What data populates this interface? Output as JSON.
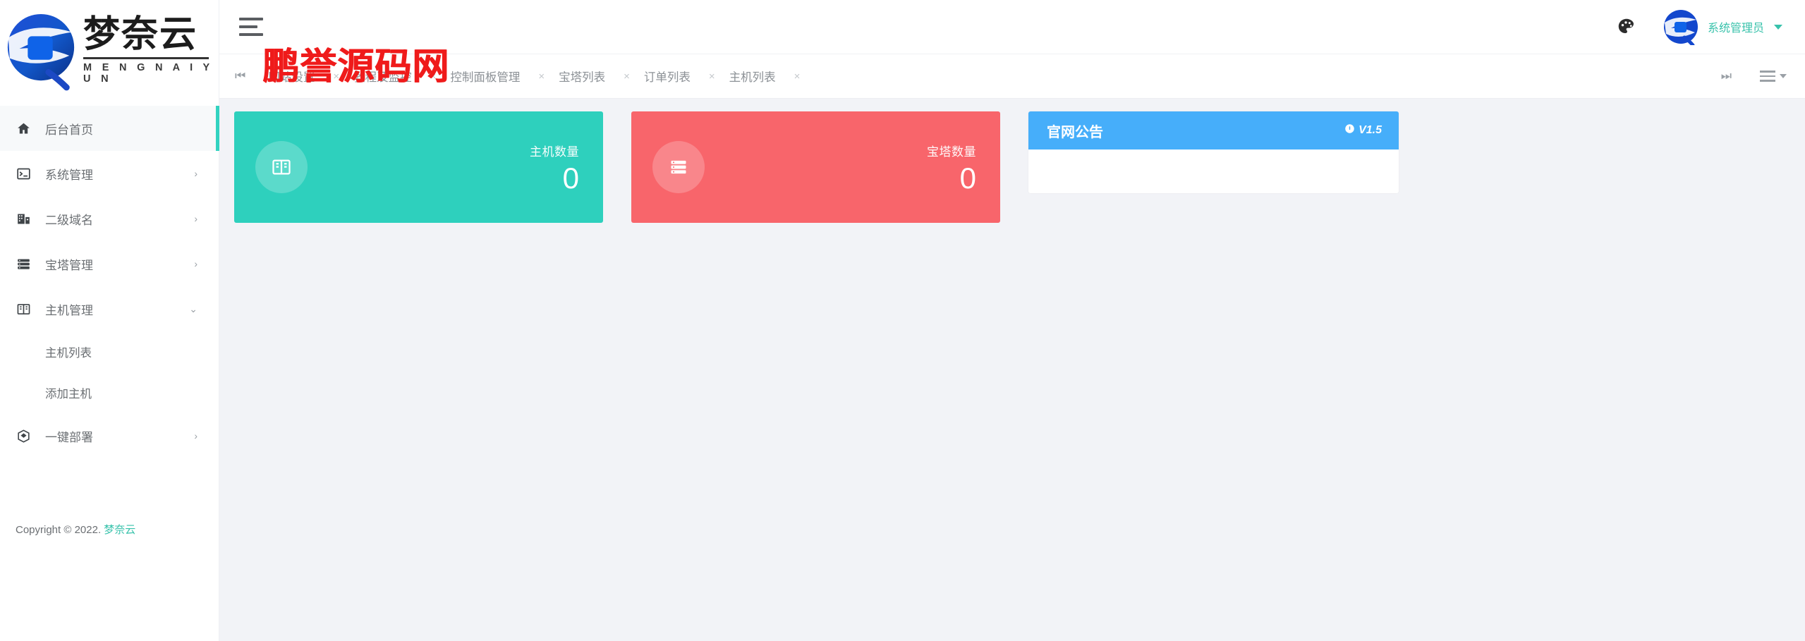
{
  "brand": {
    "name_cn": "梦奈云",
    "name_en": "M E N G N A I Y U N",
    "logo_icon": "mengnaiyun-logo-icon"
  },
  "topbar": {
    "menu_toggle_icon": "hamburger-icon",
    "theme_icon": "palette-icon",
    "avatar_icon": "user-avatar-icon",
    "user_name": "系统管理员",
    "caret_icon": "caret-down-icon"
  },
  "tabbar": {
    "scroll_left_icon": "skip-backward-icon",
    "scroll_right_icon": "skip-forward-icon",
    "menu_icon": "tab-menu-icon",
    "close_icon": "×",
    "tabs": [
      {
        "label": "网站设置",
        "closable": true
      },
      {
        "label": "教程及监控",
        "closable": true
      },
      {
        "label": "控制面板管理",
        "closable": true
      },
      {
        "label": "宝塔列表",
        "closable": true
      },
      {
        "label": "订单列表",
        "closable": true
      },
      {
        "label": "主机列表",
        "closable": true
      }
    ]
  },
  "sidebar": {
    "items": [
      {
        "label": "后台首页",
        "icon": "home-icon",
        "active": true,
        "arrow": "",
        "type": "item"
      },
      {
        "label": "系统管理",
        "icon": "terminal-icon",
        "active": false,
        "arrow": "›",
        "type": "item"
      },
      {
        "label": "二级域名",
        "icon": "domain-icon",
        "active": false,
        "arrow": "›",
        "type": "item"
      },
      {
        "label": "宝塔管理",
        "icon": "server-stack-icon",
        "active": false,
        "arrow": "›",
        "type": "item"
      },
      {
        "label": "主机管理",
        "icon": "host-icon",
        "active": false,
        "arrow": "⌄",
        "type": "item"
      },
      {
        "label": "主机列表",
        "icon": "",
        "active": false,
        "arrow": "",
        "type": "sub"
      },
      {
        "label": "添加主机",
        "icon": "",
        "active": false,
        "arrow": "",
        "type": "sub"
      },
      {
        "label": "一键部署",
        "icon": "deploy-icon",
        "active": false,
        "arrow": "›",
        "type": "item"
      }
    ],
    "copyright_text": "Copyright © 2022. ",
    "copyright_link": "梦奈云"
  },
  "content": {
    "stat_cards": [
      {
        "label": "主机数量",
        "value": "0",
        "color": "#2ed0bd",
        "icon": "host-icon"
      },
      {
        "label": "宝塔数量",
        "value": "0",
        "color": "#f8656b",
        "icon": "server-stack-icon"
      }
    ],
    "notice": {
      "title": "官网公告",
      "version": "V1.5",
      "version_icon": "info-circle-icon",
      "header_color": "#46aefa",
      "body_text": ""
    }
  },
  "watermark": {
    "text": "鹏誉源码网",
    "color": "#ef1b1b"
  },
  "colors": {
    "accent_teal": "#32d3c0",
    "accent_red": "#f8656b",
    "accent_blue": "#46aefa",
    "content_bg": "#f2f3f7"
  }
}
